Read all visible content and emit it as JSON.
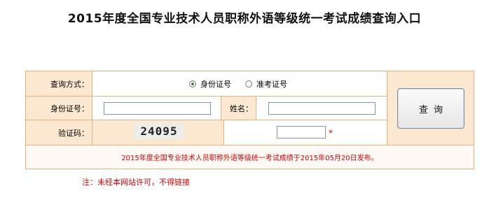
{
  "title": "2015年度全国专业技术人员职称外语等级统一考试成绩查询入口",
  "form": {
    "query_method_label": "查询方式：",
    "options": [
      {
        "label": "身份证号",
        "checked": true
      },
      {
        "label": "准考证号",
        "checked": false
      }
    ],
    "id_label": "身份证号：",
    "id_value": "",
    "name_label": "姓名：",
    "name_value": "",
    "captcha_label": "验证码：",
    "captcha_text": "24095",
    "captcha_value": "",
    "required_mark": "*",
    "query_button": "查询"
  },
  "notice": "2015年度全国专业技术人员职称外语等级统一考试成绩于2015年05月20日发布。",
  "footnote": "注：未经本网站许可，不得链接",
  "colors": {
    "border": "#e8b27a",
    "panel_bg": "#fde8d2",
    "notice_red": "#cc0000",
    "radio_checked": "#3a8a3a"
  }
}
